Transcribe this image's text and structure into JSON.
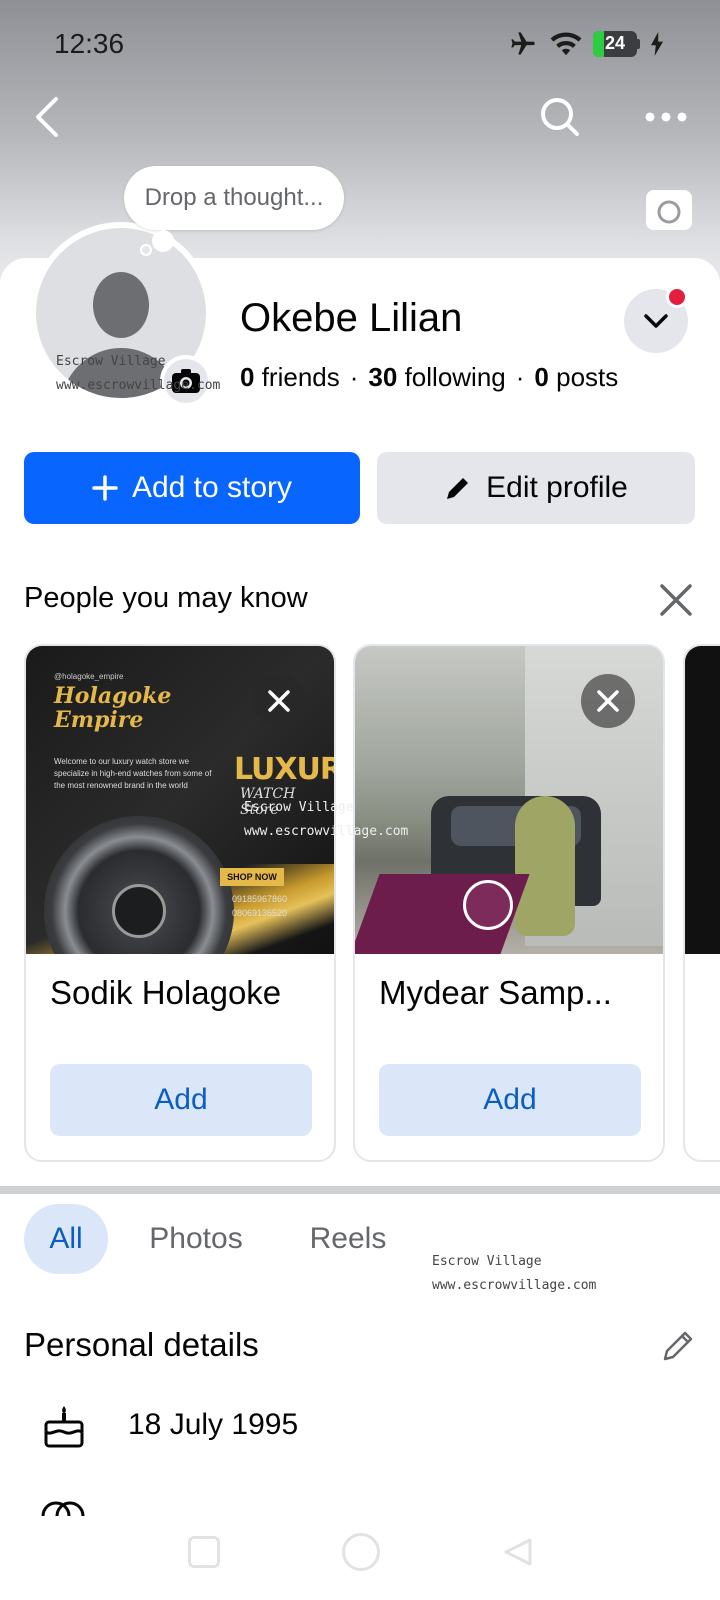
{
  "status_bar": {
    "time": "12:36",
    "battery": "24",
    "battery_level": 0.24
  },
  "profile": {
    "thought_placeholder": "Drop a thought...",
    "name": "Okebe Lilian",
    "friends_count": "0",
    "friends_label": "friends",
    "following_count": "30",
    "following_label": "following",
    "posts_count": "0",
    "posts_label": "posts"
  },
  "actions": {
    "add_story": "Add to story",
    "edit_profile": "Edit profile"
  },
  "pymk": {
    "title": "People you may know",
    "cards": [
      {
        "name": "Sodik Holagoke",
        "add": "Add",
        "image": {
          "handle": "@holagoke_empire",
          "brand_line1": "Holagoke",
          "brand_line2": "Empire",
          "blurb": "Welcome to our luxury watch store we specialize in high-end watches from some of the most renowned brand in the world",
          "headline": "LUXURY",
          "subline": "WATCH Store",
          "shop": "SHOP NOW",
          "phone1": "09185967860",
          "phone2": "08069136520"
        }
      },
      {
        "name": "Mydear Samp...",
        "add": "Add"
      }
    ]
  },
  "tabs": [
    {
      "label": "All"
    },
    {
      "label": "Photos"
    },
    {
      "label": "Reels"
    }
  ],
  "details": {
    "title": "Personal details",
    "birthday": "18 July 1995"
  },
  "watermark": {
    "line1": "Escrow Village",
    "line2": "www.escrowvillage.com"
  },
  "colors": {
    "primary": "#0866ff",
    "secondary_bg": "#e4e6eb",
    "add_bg": "#dbe7f8",
    "add_text": "#0a5dc2",
    "notification": "#e41e3f"
  }
}
